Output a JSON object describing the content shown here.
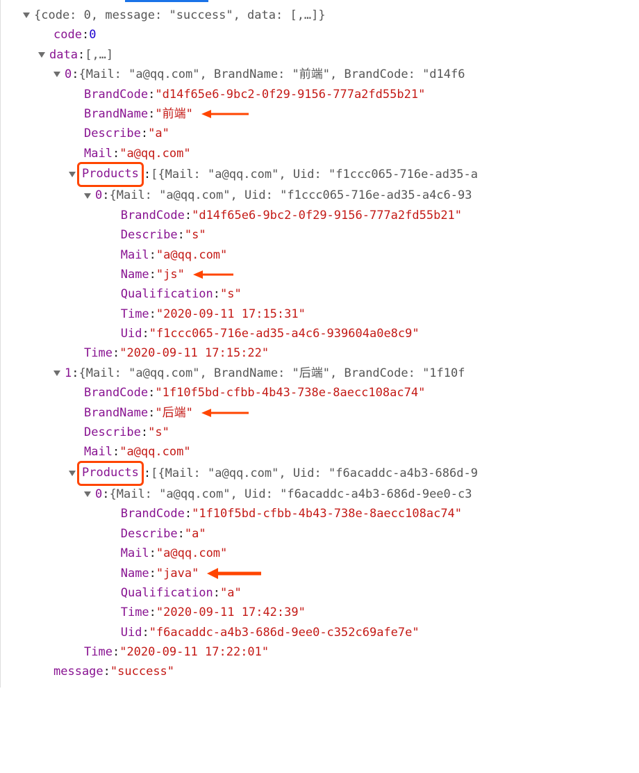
{
  "root_preview": "{code: 0, message: \"success\", data: [,…]}",
  "code_key": "code",
  "code_val": "0",
  "data_key": "data",
  "data_preview": "[,…]",
  "message_key": "message",
  "message_val": "\"success\"",
  "item0": {
    "idx": "0",
    "preview": "{Mail: \"a@qq.com\", BrandName: \"前端\", BrandCode: \"d14f6",
    "BrandCode_k": "BrandCode",
    "BrandCode_v": "\"d14f65e6-9bc2-0f29-9156-777a2fd55b21\"",
    "BrandName_k": "BrandName",
    "BrandName_v": "\"前端\"",
    "Describe_k": "Describe",
    "Describe_v": "\"a\"",
    "Mail_k": "Mail",
    "Mail_v": "\"a@qq.com\"",
    "Products_k": "Products",
    "Products_preview": "[{Mail: \"a@qq.com\", Uid: \"f1ccc065-716e-ad35-a",
    "p0": {
      "idx": "0",
      "preview": "{Mail: \"a@qq.com\", Uid: \"f1ccc065-716e-ad35-a4c6-93",
      "BrandCode_k": "BrandCode",
      "BrandCode_v": "\"d14f65e6-9bc2-0f29-9156-777a2fd55b21\"",
      "Describe_k": "Describe",
      "Describe_v": "\"s\"",
      "Mail_k": "Mail",
      "Mail_v": "\"a@qq.com\"",
      "Name_k": "Name",
      "Name_v": "\"js\"",
      "Qualification_k": "Qualification",
      "Qualification_v": "\"s\"",
      "Time_k": "Time",
      "Time_v": "\"2020-09-11 17:15:31\"",
      "Uid_k": "Uid",
      "Uid_v": "\"f1ccc065-716e-ad35-a4c6-939604a0e8c9\""
    },
    "Time_k": "Time",
    "Time_v": "\"2020-09-11 17:15:22\""
  },
  "item1": {
    "idx": "1",
    "preview": "{Mail: \"a@qq.com\", BrandName: \"后端\", BrandCode: \"1f10f",
    "BrandCode_k": "BrandCode",
    "BrandCode_v": "\"1f10f5bd-cfbb-4b43-738e-8aecc108ac74\"",
    "BrandName_k": "BrandName",
    "BrandName_v": "\"后端\"",
    "Describe_k": "Describe",
    "Describe_v": "\"s\"",
    "Mail_k": "Mail",
    "Mail_v": "\"a@qq.com\"",
    "Products_k": "Products",
    "Products_preview": "[{Mail: \"a@qq.com\", Uid: \"f6acaddc-a4b3-686d-9",
    "p0": {
      "idx": "0",
      "preview": "{Mail: \"a@qq.com\", Uid: \"f6acaddc-a4b3-686d-9ee0-c3",
      "BrandCode_k": "BrandCode",
      "BrandCode_v": "\"1f10f5bd-cfbb-4b43-738e-8aecc108ac74\"",
      "Describe_k": "Describe",
      "Describe_v": "\"a\"",
      "Mail_k": "Mail",
      "Mail_v": "\"a@qq.com\"",
      "Name_k": "Name",
      "Name_v": "\"java\"",
      "Qualification_k": "Qualification",
      "Qualification_v": "\"a\"",
      "Time_k": "Time",
      "Time_v": "\"2020-09-11 17:42:39\"",
      "Uid_k": "Uid",
      "Uid_v": "\"f6acaddc-a4b3-686d-9ee0-c352c69afe7e\""
    },
    "Time_k": "Time",
    "Time_v": "\"2020-09-11 17:22:01\""
  }
}
